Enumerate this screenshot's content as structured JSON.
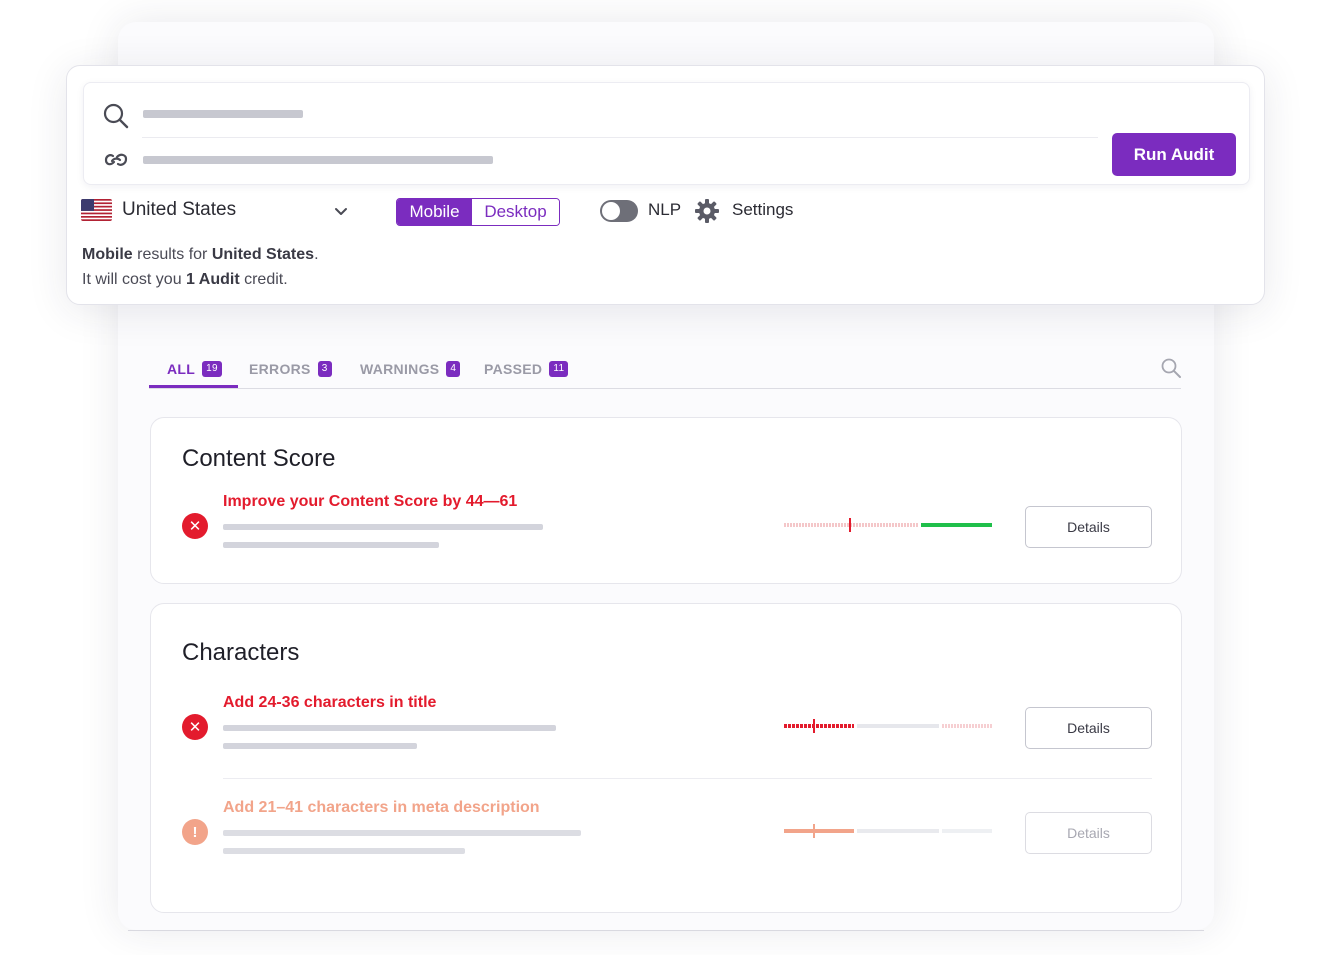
{
  "audit": {
    "run_label": "Run Audit",
    "country": "United States",
    "device": {
      "active": "Mobile",
      "inactive": "Desktop"
    },
    "nlp_label": "NLP",
    "nlp_enabled": false,
    "settings_label": "Settings",
    "info": {
      "device_bold": "Mobile",
      "middle": " results for ",
      "country_bold": "United States",
      "end": ".",
      "cost_prefix": "It will cost you ",
      "cost_bold": "1 Audit",
      "cost_suffix": " credit."
    }
  },
  "tabs": [
    {
      "label": "ALL",
      "count": "19"
    },
    {
      "label": "ERRORS",
      "count": "3"
    },
    {
      "label": "WARNINGS",
      "count": "4"
    },
    {
      "label": "PASSED",
      "count": "11"
    }
  ],
  "sections": [
    {
      "title": "Content Score",
      "items": [
        {
          "status": "error",
          "title": "Improve your Content Score by 44—61",
          "details_label": "Details"
        }
      ]
    },
    {
      "title": "Characters",
      "items": [
        {
          "status": "error",
          "title": "Add 24-36 characters in title",
          "details_label": "Details"
        },
        {
          "status": "warning",
          "title": "Add 21–41 characters in meta description",
          "details_label": "Details"
        }
      ]
    }
  ],
  "colors": {
    "accent": "#7b2cbf",
    "error": "#e31b2d",
    "warning": "#f2a48a",
    "success": "#1fbf4a"
  }
}
